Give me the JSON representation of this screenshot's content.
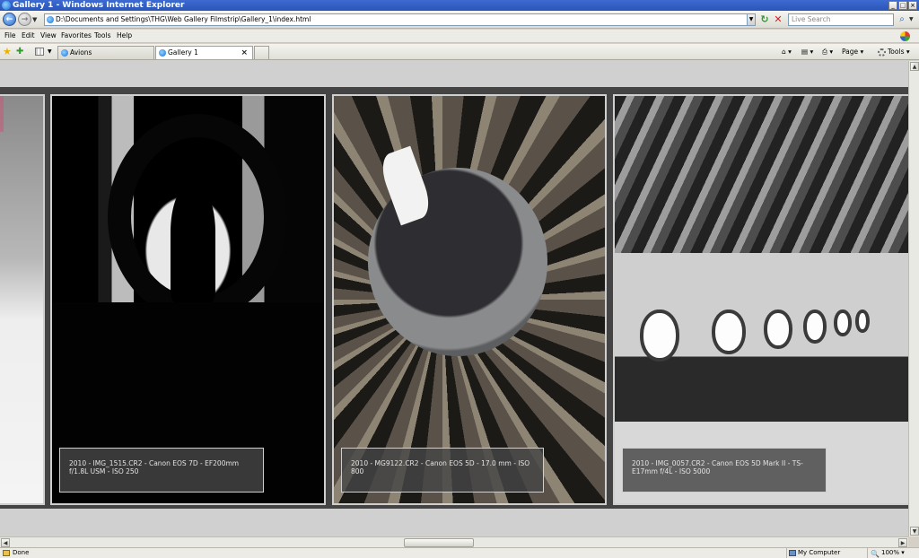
{
  "window": {
    "title": "Gallery 1 - Windows Internet Explorer",
    "controls": {
      "minimize": "_",
      "maximize": "□",
      "close": "×"
    }
  },
  "addressbar": {
    "url": "D:\\Documents and Settings\\THG\\Web Gallery Filmstrip\\Gallery_1\\index.html",
    "back": "←",
    "forward": "→",
    "dropdown": "▼",
    "refresh": "↻",
    "stop": "✕",
    "search_placeholder": "Live Search",
    "search_button": "⌕"
  },
  "menubar": {
    "items": [
      "File",
      "Edit",
      "View",
      "Favorites",
      "Tools",
      "Help"
    ]
  },
  "tabbar": {
    "favorites_icon": "★",
    "add_favorite_icon": "✚",
    "tabs": [
      {
        "label": "Avions",
        "active": false
      },
      {
        "label": "Gallery 1",
        "active": true,
        "close": "×"
      }
    ],
    "commands": {
      "home": "⌂",
      "feeds": "▤",
      "print": "⎙",
      "page": "Page",
      "tools": "Tools"
    }
  },
  "gallery": {
    "photos": [
      {
        "caption": ""
      },
      {
        "caption": "2010 - IMG_1515.CR2 - Canon EOS 7D - EF200mm f/1.8L USM - ISO 250"
      },
      {
        "caption": "2010 - MG9122.CR2 - Canon EOS 5D - 17.0 mm - ISO 800"
      },
      {
        "caption": "2010 - IMG_0057.CR2 - Canon EOS 5D Mark II - TS-E17mm f/4L - ISO 5000"
      }
    ]
  },
  "scrollbars": {
    "up": "▲",
    "down": "▼",
    "left": "◀",
    "right": "▶"
  },
  "statusbar": {
    "status": "Done",
    "zone": "My Computer",
    "zoom": "100%",
    "zoom_icon": "🔍"
  }
}
